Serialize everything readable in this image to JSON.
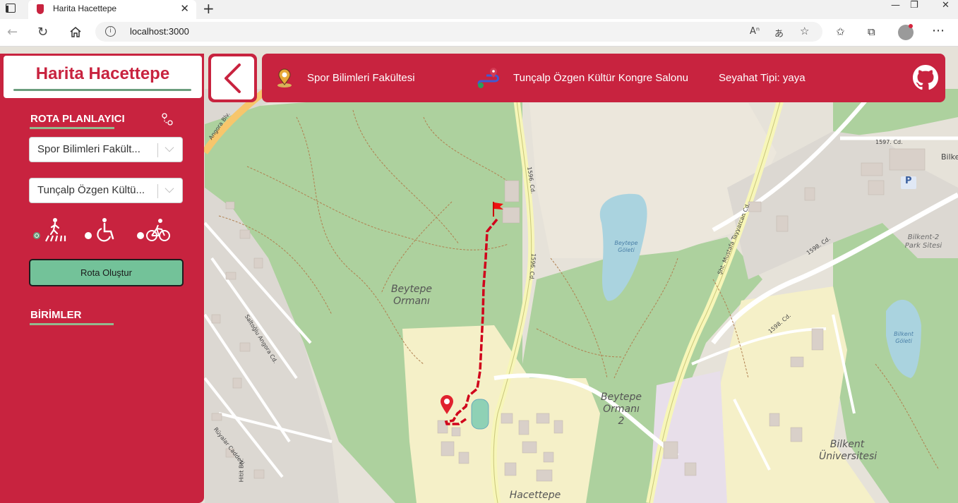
{
  "browser": {
    "tab_title": "Harita Hacettepe",
    "new_tab_icon": "+",
    "url": "localhost:3000",
    "window_controls": [
      "—",
      "❐",
      "✕"
    ]
  },
  "sidebar": {
    "brand_title": "Harita Hacettepe",
    "route_planner_title": "ROTA PLANLAYICI",
    "origin_value": "Spor Bilimleri Fakült...",
    "destination_value": "Tunçalp Özgen Kültü...",
    "travel_modes": [
      {
        "mode": "pedestrian",
        "icon": "pedestrian-crossing-icon",
        "checked": true
      },
      {
        "mode": "wheelchair",
        "icon": "wheelchair-icon",
        "checked": false
      },
      {
        "mode": "bicycle",
        "icon": "bicycle-icon",
        "checked": false
      }
    ],
    "create_route_button": "Rota Oluştur",
    "units_title": "BİRİMLER"
  },
  "infobar": {
    "origin": "Spor Bilimleri Fakültesi",
    "destination": "Tunçalp Özgen Kültür Kongre Salonu",
    "travel_type": "Seyahat Tipi: yaya"
  },
  "map": {
    "labels": {
      "forest1": "Beytepe\nOrmanı",
      "forest2": "Beytepe\nOrmanı\n2",
      "lake1": "Beytepe\nGöleti",
      "lake2": "Bilkent\nGöleti",
      "bilkent_uni": "Bilkent\nÜniversitesi",
      "hacettepe": "Hacettepe",
      "park": "Bilkent-2\nPark Sitesi",
      "road1596a": "1596. Cd.",
      "road1596b": "1596. Cd.",
      "mustafa": "Şht. Mustafa Tayyarcan Cd.",
      "road1598a": "1598. Cd.",
      "road1598b": "1598. Cd.",
      "road1597": "1597. Cd.",
      "bilke": "Bilke",
      "saltoglu": "Saltoğlu Angora Cd.",
      "ruyalar": "Rüyalar Caddesi",
      "hitit": "Hitit Blv.",
      "angora": "Angora Blv.",
      "parking": "P"
    }
  },
  "colors": {
    "brand": "#c8233f",
    "accent_green": "#73c299",
    "forest": "#add19e",
    "route": "#d0021b"
  }
}
